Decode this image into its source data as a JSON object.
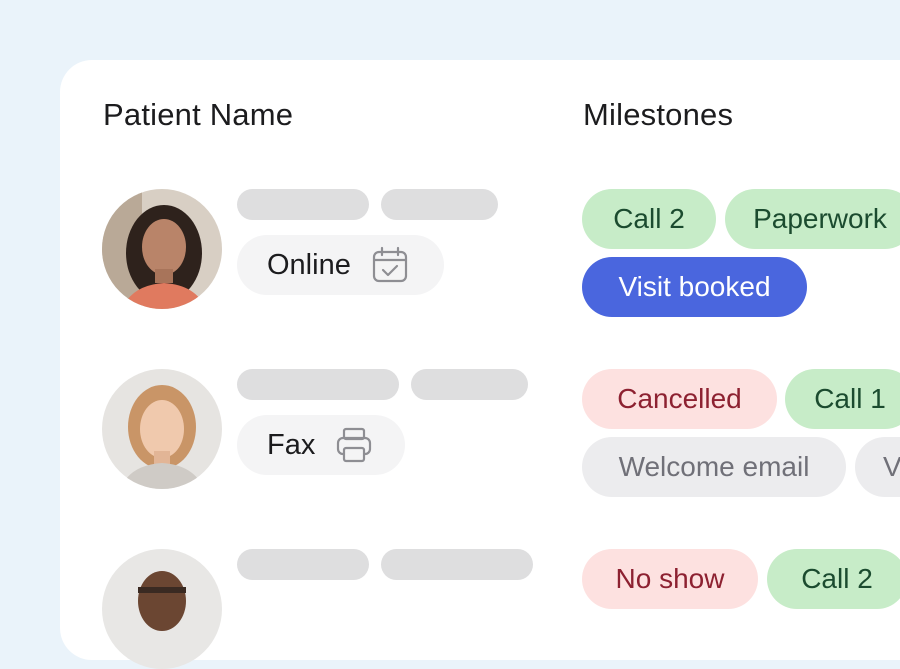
{
  "table": {
    "headers": {
      "patient_name": "Patient Name",
      "milestones": "Milestones"
    },
    "rows": [
      {
        "method": {
          "label": "Online",
          "icon": "calendar-check-icon"
        },
        "milestones": [
          {
            "label": "Call 2",
            "status": "green"
          },
          {
            "label": "Paperwork",
            "status": "green"
          },
          {
            "label": "Visit booked",
            "status": "blue"
          }
        ]
      },
      {
        "method": {
          "label": "Fax",
          "icon": "printer-icon"
        },
        "milestones": [
          {
            "label": "Cancelled",
            "status": "red"
          },
          {
            "label": "Call 1",
            "status": "green"
          },
          {
            "label": "Welcome email",
            "status": "grey"
          },
          {
            "label": "V",
            "status": "grey"
          }
        ]
      },
      {
        "method": null,
        "milestones": [
          {
            "label": "No show",
            "status": "red"
          },
          {
            "label": "Call 2",
            "status": "green"
          }
        ]
      }
    ]
  },
  "colors": {
    "background": "#eaf3fa",
    "card": "#ffffff",
    "skeleton": "#dededf",
    "chip_green": "#c7ecc8",
    "chip_blue": "#4a66de",
    "chip_red": "#fde1e0",
    "chip_grey": "#ececee"
  }
}
